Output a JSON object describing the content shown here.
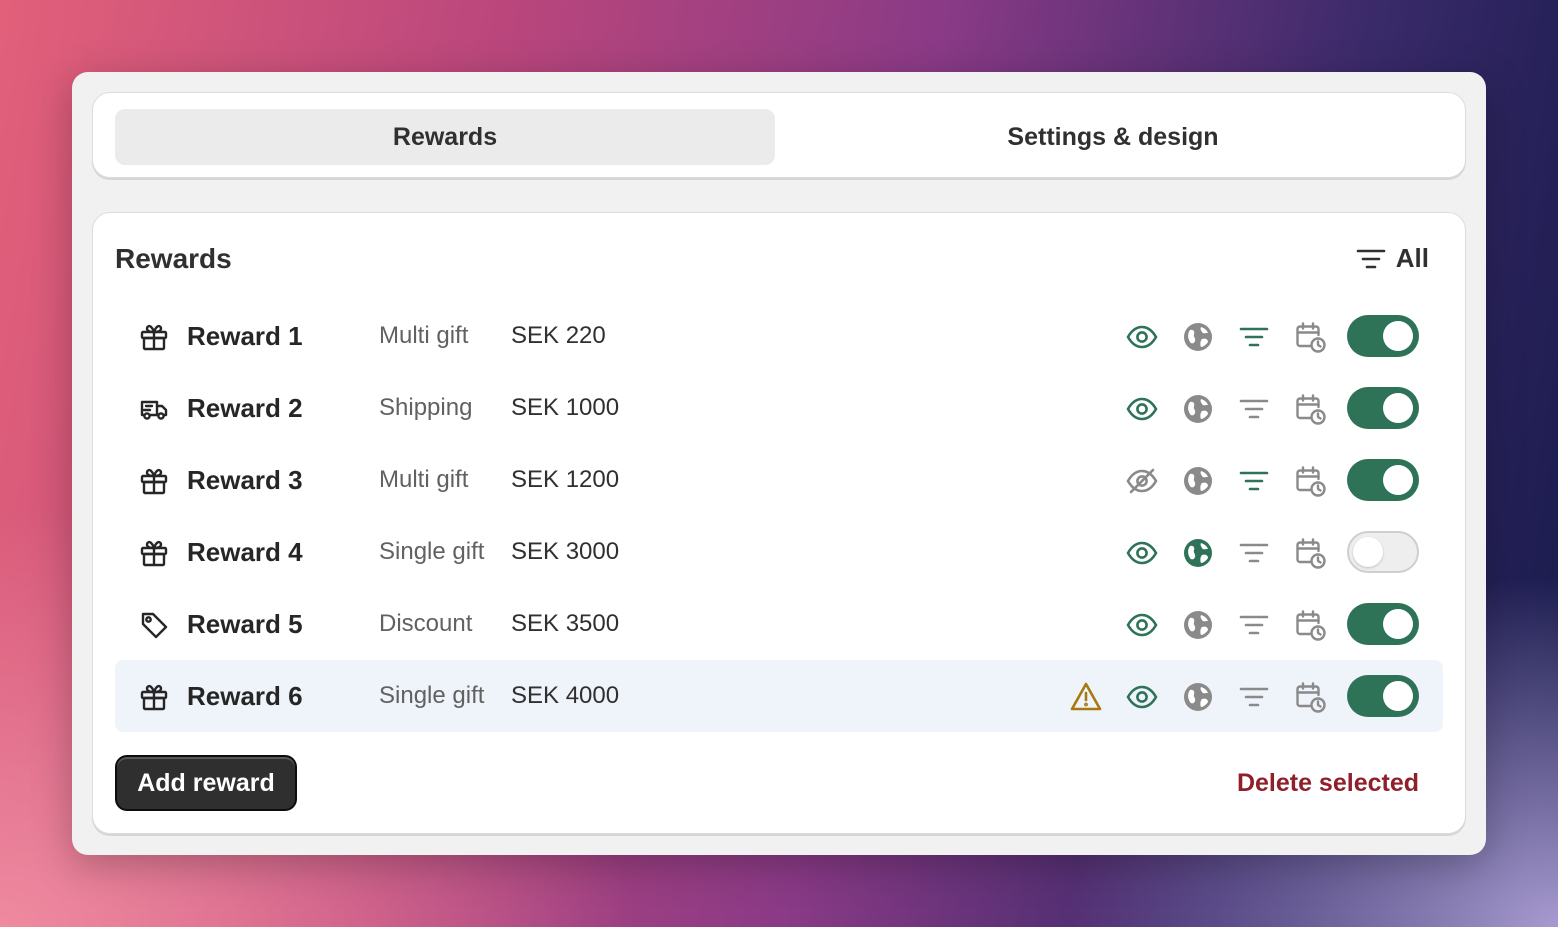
{
  "tabs": [
    {
      "label": "Rewards",
      "active": true
    },
    {
      "label": "Settings & design",
      "active": false
    }
  ],
  "section": {
    "title": "Rewards",
    "filter_label": "All"
  },
  "rewards": [
    {
      "icon": "gift-icon",
      "name": "Reward 1",
      "type": "Multi gift",
      "amount": "SEK 220",
      "visible": true,
      "global_active": false,
      "filter_active": true,
      "enabled": true,
      "warning": false,
      "selected": false
    },
    {
      "icon": "truck-icon",
      "name": "Reward 2",
      "type": "Shipping",
      "amount": "SEK 1000",
      "visible": true,
      "global_active": false,
      "filter_active": false,
      "enabled": true,
      "warning": false,
      "selected": false
    },
    {
      "icon": "gift-icon",
      "name": "Reward 3",
      "type": "Multi gift",
      "amount": "SEK 1200",
      "visible": false,
      "global_active": false,
      "filter_active": true,
      "enabled": true,
      "warning": false,
      "selected": false
    },
    {
      "icon": "gift-icon",
      "name": "Reward 4",
      "type": "Single gift",
      "amount": "SEK 3000",
      "visible": true,
      "global_active": true,
      "filter_active": false,
      "enabled": false,
      "warning": false,
      "selected": false
    },
    {
      "icon": "tag-icon",
      "name": "Reward 5",
      "type": "Discount",
      "amount": "SEK 3500",
      "visible": true,
      "global_active": false,
      "filter_active": false,
      "enabled": true,
      "warning": false,
      "selected": false
    },
    {
      "icon": "gift-icon",
      "name": "Reward 6",
      "type": "Single gift",
      "amount": "SEK 4000",
      "visible": true,
      "global_active": false,
      "filter_active": false,
      "enabled": true,
      "warning": true,
      "selected": true
    }
  ],
  "actions": {
    "add_label": "Add reward",
    "delete_label": "Delete selected"
  },
  "colors": {
    "accent_green": "#2e7358",
    "icon_gray": "#8a8a8a",
    "warning": "#a8790f",
    "danger": "#8e1f2b",
    "selected_row": "#eff4fb"
  }
}
